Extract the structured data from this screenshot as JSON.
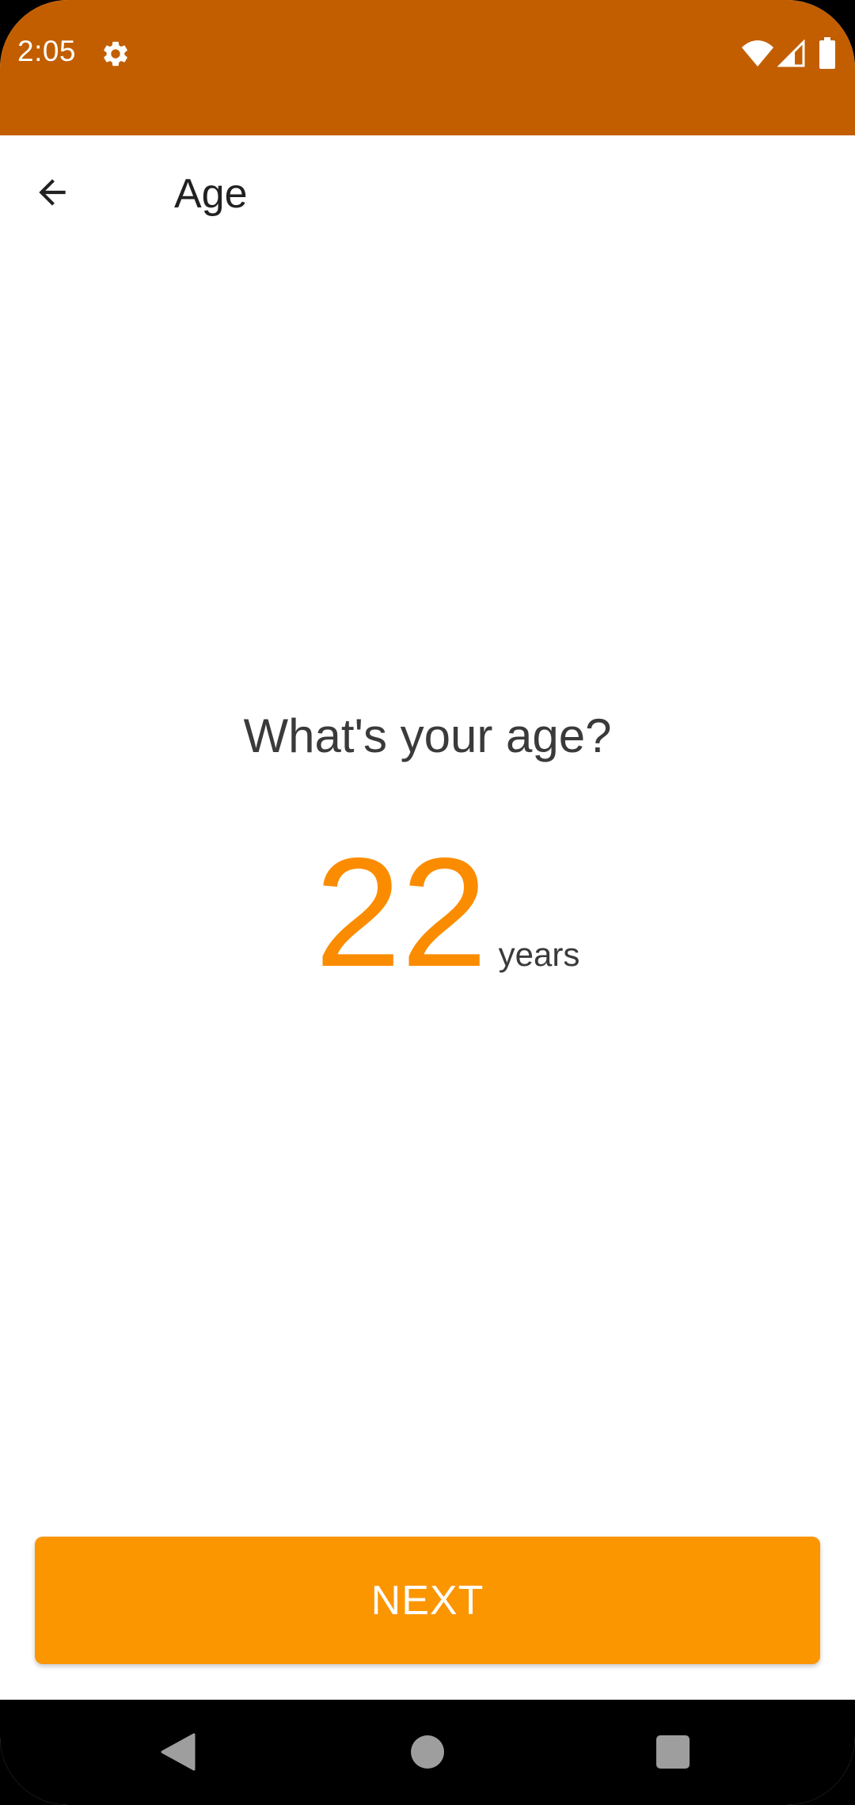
{
  "status_bar": {
    "time": "2:05",
    "background_color": "#c25e00",
    "icons": [
      "gear-icon",
      "wifi-icon",
      "cell-signal-icon",
      "battery-icon"
    ]
  },
  "app_bar": {
    "title": "Age",
    "back_icon": "arrow-back-icon"
  },
  "content": {
    "question": "What's your age?",
    "age_value": "22",
    "age_unit": "years",
    "accent_color": "#fb8c00"
  },
  "actions": {
    "next_label": "NEXT",
    "button_color": "#fb9500"
  },
  "nav_bar": {
    "icons": [
      "nav-back-icon",
      "nav-home-icon",
      "nav-recents-icon"
    ]
  }
}
